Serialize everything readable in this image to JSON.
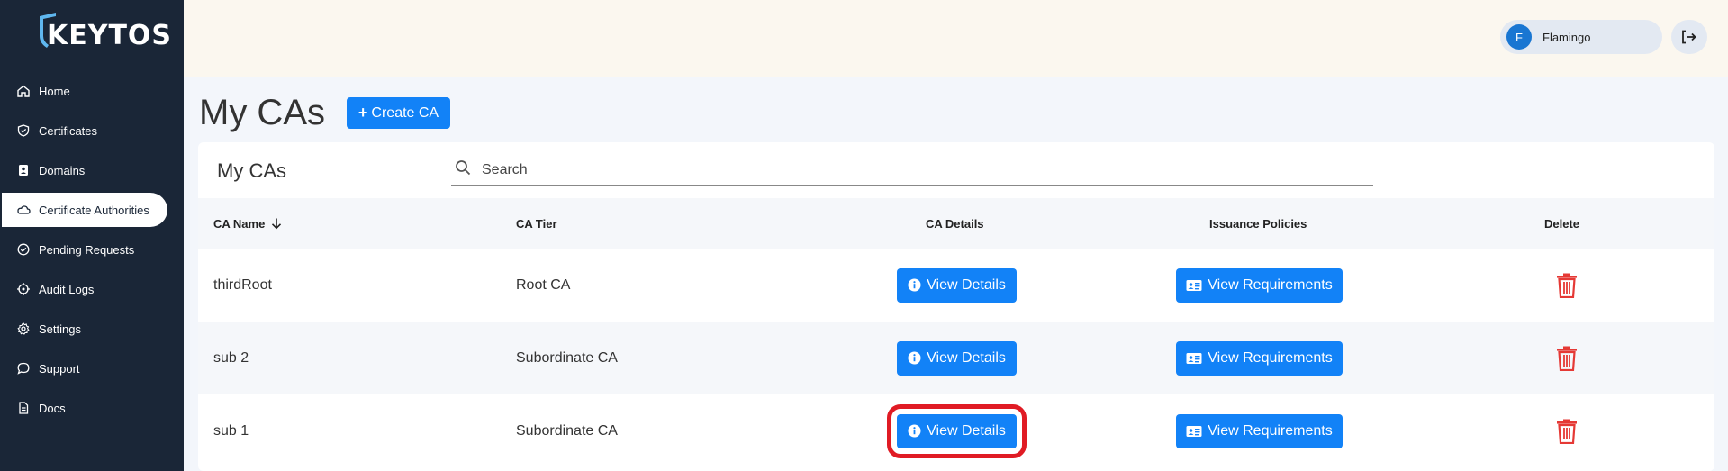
{
  "brand": {
    "logo_text": "KEYTOS"
  },
  "sidebar": {
    "items": [
      {
        "label": "Home",
        "icon": "home-icon"
      },
      {
        "label": "Certificates",
        "icon": "shield-icon"
      },
      {
        "label": "Domains",
        "icon": "contact-card-icon"
      },
      {
        "label": "Certificate Authorities",
        "icon": "cloud-icon",
        "active": true
      },
      {
        "label": "Pending Requests",
        "icon": "check-circle-icon"
      },
      {
        "label": "Audit Logs",
        "icon": "target-icon"
      },
      {
        "label": "Settings",
        "icon": "gear-icon"
      },
      {
        "label": "Support",
        "icon": "chat-bubble-icon"
      },
      {
        "label": "Docs",
        "icon": "document-icon"
      }
    ]
  },
  "topbar": {
    "user": {
      "initial": "F",
      "name": "Flamingo"
    },
    "logout_icon": "logout-icon"
  },
  "main": {
    "title": "My CAs",
    "create_button": "Create CA"
  },
  "table": {
    "title": "My CAs",
    "search_placeholder": "Search",
    "columns": {
      "name": "CA Name",
      "tier": "CA Tier",
      "details": "CA Details",
      "policies": "Issuance Policies",
      "delete": "Delete"
    },
    "sort_icon": "arrow-down-icon",
    "rows": [
      {
        "name": "thirdRoot",
        "tier": "Root CA",
        "details_label": "View Details",
        "policies_label": "View Requirements"
      },
      {
        "name": "sub 2",
        "tier": "Subordinate CA",
        "details_label": "View Details",
        "policies_label": "View Requirements"
      },
      {
        "name": "sub 1",
        "tier": "Subordinate CA",
        "details_label": "View Details",
        "policies_label": "View Requirements",
        "highlighted": true
      }
    ]
  },
  "colors": {
    "sidebar_bg": "#1a2637",
    "accent": "#1282f7",
    "delete": "#e53935",
    "highlight": "#e01b24"
  }
}
